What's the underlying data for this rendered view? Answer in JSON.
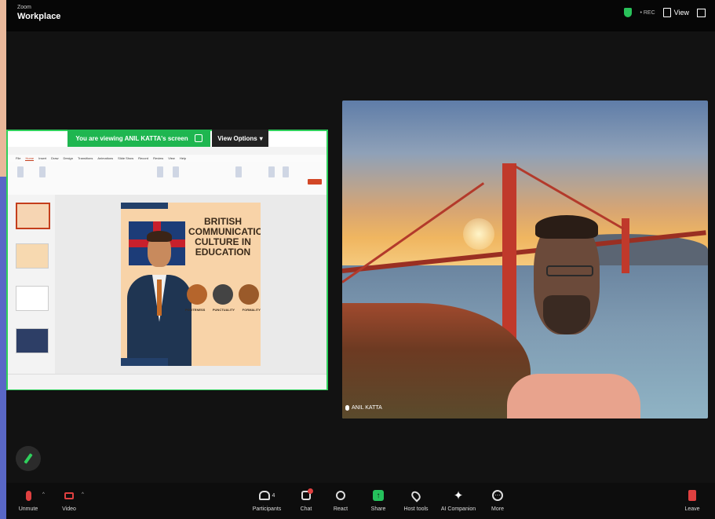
{
  "app": {
    "brand_small": "Zoom",
    "brand_title": "Workplace"
  },
  "topbar": {
    "recording_text": "• REC",
    "view_label": "View"
  },
  "share": {
    "banner_text": "You are viewing  ANIL KATTA's screen",
    "view_options_label": "View Options",
    "ribbon_tabs": [
      "File",
      "Home",
      "Insert",
      "Draw",
      "Design",
      "Transitions",
      "Animations",
      "Slide Show",
      "Record",
      "Review",
      "View",
      "Help"
    ],
    "slide_title": "BRITISH COMMUNICATION CULTURE IN EDUCATION",
    "slide_labels": [
      "POLITENESS",
      "PUNCTUALITY",
      "FORMALITY"
    ]
  },
  "participant": {
    "name": "ANIL KATTA"
  },
  "toolbar": {
    "unmute": "Unmute",
    "video": "Video",
    "participants": "Participants",
    "participants_count": "4",
    "chat": "Chat",
    "react": "React",
    "share": "Share",
    "host_tools": "Host tools",
    "ai_companion": "AI Companion",
    "more": "More",
    "leave": "Leave"
  },
  "colors": {
    "share_border": "#2fd05c",
    "banner_green": "#1fb650",
    "leave_red": "#e04040",
    "ppt_accent": "#c43e1c"
  }
}
